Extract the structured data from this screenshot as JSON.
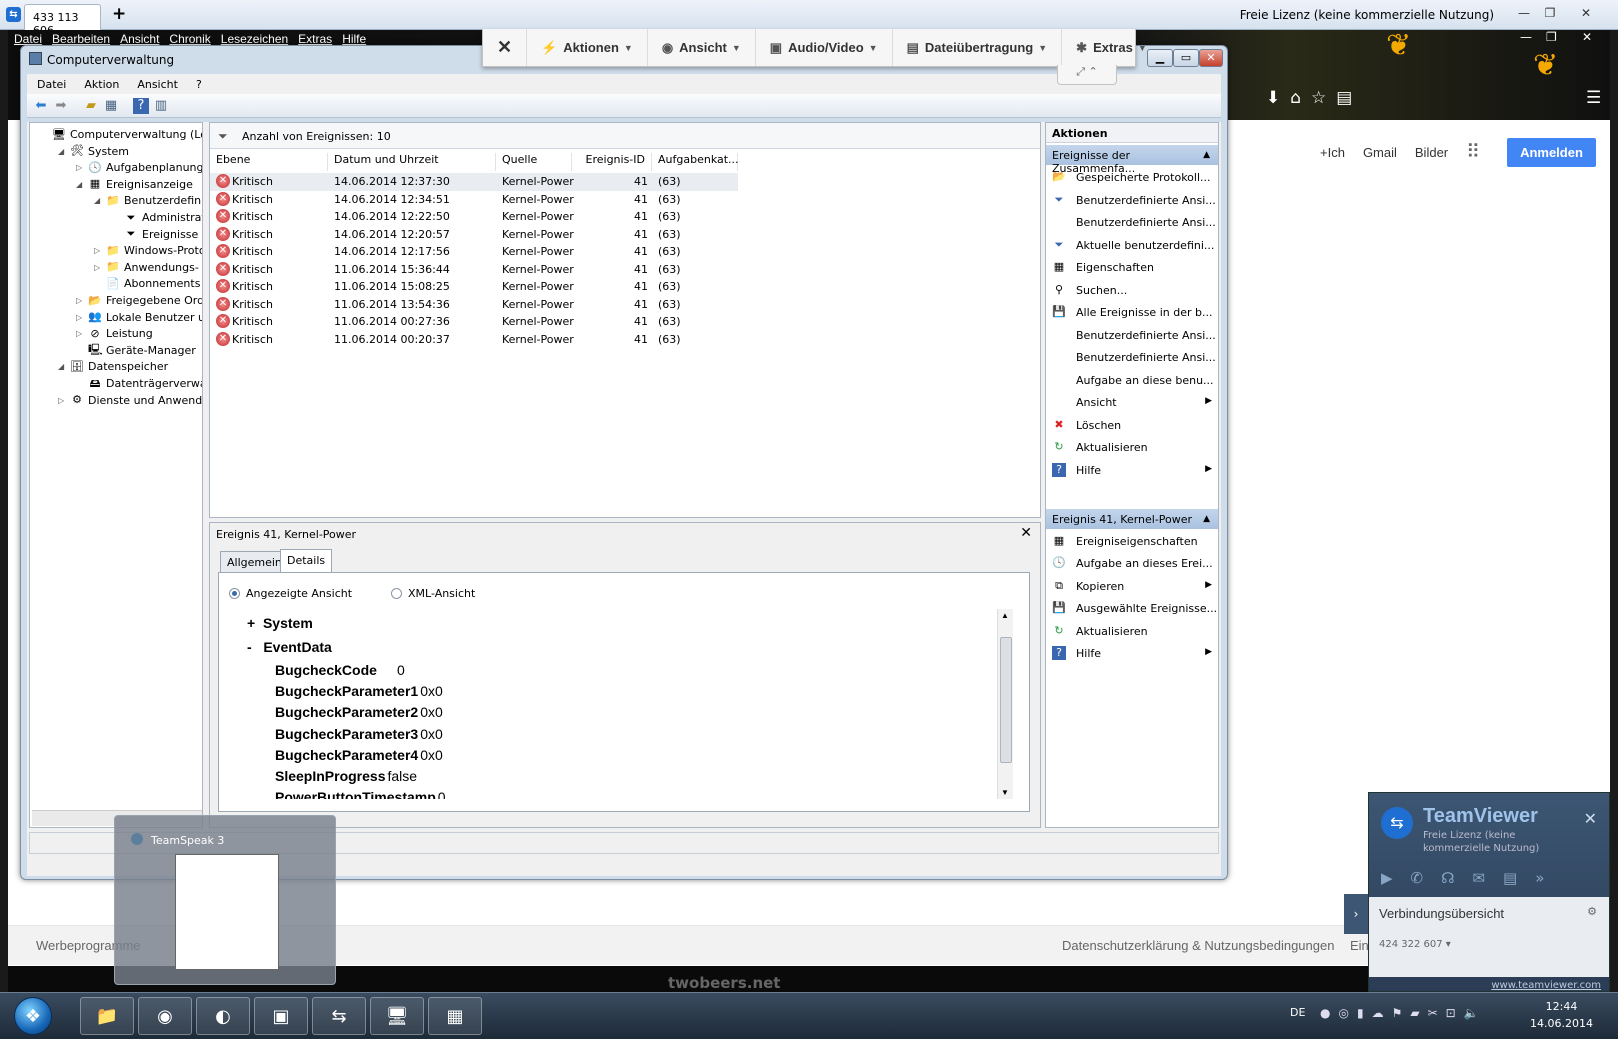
{
  "tv_window": {
    "tab_label": "433 113 606",
    "new_tab": "+",
    "license": "Freie Lizenz (keine kommerzielle Nutzung)",
    "controls": [
      "—",
      "❐",
      "✕"
    ]
  },
  "browser": {
    "menu": [
      "Datei",
      "Bearbeiten",
      "Ansicht",
      "Chronik",
      "Lesezeichen",
      "Extras",
      "Hilfe"
    ],
    "controls": [
      "—",
      "❐",
      "✕"
    ],
    "google_links": [
      "+Ich",
      "Gmail",
      "Bilder"
    ],
    "signin": "Anmelden",
    "footer_left": "Werbeprogramme",
    "footer_right": "Datenschutzerklärung & Nutzungsbedingungen",
    "footer_ein": "Ein",
    "status_brand": "twobeers.net"
  },
  "tv_toolbar": {
    "close": "✕",
    "items": [
      {
        "icon": "⚡",
        "label": "Aktionen"
      },
      {
        "icon": "◉",
        "label": "Ansicht"
      },
      {
        "icon": "▣",
        "label": "Audio/Video"
      },
      {
        "icon": "▤",
        "label": "Dateiübertragung"
      },
      {
        "icon": "✱",
        "label": "Extras"
      }
    ],
    "tab_icons": "⤢  ⌃"
  },
  "mmc": {
    "title": "Computerverwaltung",
    "menu": [
      "Datei",
      "Aktion",
      "Ansicht",
      "?"
    ],
    "tree": [
      {
        "label": "Computerverwaltung (Lokal)",
        "icon": "🖥",
        "level": 0,
        "arrow": ""
      },
      {
        "label": "System",
        "icon": "🛠",
        "level": 1,
        "arrow": "◢"
      },
      {
        "label": "Aufgabenplanung",
        "icon": "🕓",
        "level": 2,
        "arrow": "▷"
      },
      {
        "label": "Ereignisanzeige",
        "icon": "▦",
        "level": 2,
        "arrow": "◢"
      },
      {
        "label": "Benutzerdefinierte A",
        "icon": "📁",
        "level": 3,
        "arrow": "◢"
      },
      {
        "label": "Administrative E",
        "icon": "⏷",
        "level": 4,
        "arrow": ""
      },
      {
        "label": "Ereignisse der Zu",
        "icon": "⏷",
        "level": 4,
        "arrow": ""
      },
      {
        "label": "Windows-Protokolle",
        "icon": "📁",
        "level": 3,
        "arrow": "▷"
      },
      {
        "label": "Anwendungs- und D",
        "icon": "📁",
        "level": 3,
        "arrow": "▷"
      },
      {
        "label": "Abonnements",
        "icon": "📄",
        "level": 3,
        "arrow": ""
      },
      {
        "label": "Freigegebene Ordner",
        "icon": "📂",
        "level": 2,
        "arrow": "▷"
      },
      {
        "label": "Lokale Benutzer und Gr",
        "icon": "👥",
        "level": 2,
        "arrow": "▷"
      },
      {
        "label": "Leistung",
        "icon": "⊘",
        "level": 2,
        "arrow": "▷"
      },
      {
        "label": "Geräte-Manager",
        "icon": "🖳",
        "level": 2,
        "arrow": ""
      },
      {
        "label": "Datenspeicher",
        "icon": "🗄",
        "level": 1,
        "arrow": "◢"
      },
      {
        "label": "Datenträgerverwaltung",
        "icon": "🖴",
        "level": 2,
        "arrow": ""
      },
      {
        "label": "Dienste und Anwendungen",
        "icon": "⚙",
        "level": 1,
        "arrow": "▷"
      }
    ],
    "count_text": "Anzahl von Ereignissen: 10",
    "columns": [
      "Ebene",
      "Datum und Uhrzeit",
      "Quelle",
      "Ereignis-ID",
      "Aufgabenkat..."
    ],
    "events": [
      {
        "level": "Kritisch",
        "datetime": "14.06.2014 12:37:30",
        "source": "Kernel-Power",
        "id": "41",
        "cat": "(63)"
      },
      {
        "level": "Kritisch",
        "datetime": "14.06.2014 12:34:51",
        "source": "Kernel-Power",
        "id": "41",
        "cat": "(63)"
      },
      {
        "level": "Kritisch",
        "datetime": "14.06.2014 12:22:50",
        "source": "Kernel-Power",
        "id": "41",
        "cat": "(63)"
      },
      {
        "level": "Kritisch",
        "datetime": "14.06.2014 12:20:57",
        "source": "Kernel-Power",
        "id": "41",
        "cat": "(63)"
      },
      {
        "level": "Kritisch",
        "datetime": "14.06.2014 12:17:56",
        "source": "Kernel-Power",
        "id": "41",
        "cat": "(63)"
      },
      {
        "level": "Kritisch",
        "datetime": "11.06.2014 15:36:44",
        "source": "Kernel-Power",
        "id": "41",
        "cat": "(63)"
      },
      {
        "level": "Kritisch",
        "datetime": "11.06.2014 15:08:25",
        "source": "Kernel-Power",
        "id": "41",
        "cat": "(63)"
      },
      {
        "level": "Kritisch",
        "datetime": "11.06.2014 13:54:36",
        "source": "Kernel-Power",
        "id": "41",
        "cat": "(63)"
      },
      {
        "level": "Kritisch",
        "datetime": "11.06.2014 00:27:36",
        "source": "Kernel-Power",
        "id": "41",
        "cat": "(63)"
      },
      {
        "level": "Kritisch",
        "datetime": "11.06.2014 00:20:37",
        "source": "Kernel-Power",
        "id": "41",
        "cat": "(63)"
      }
    ],
    "detail": {
      "title": "Ereignis 41, Kernel-Power",
      "tabs": [
        "Allgemein",
        "Details"
      ],
      "radio_friendly": "Angezeigte Ansicht",
      "radio_xml": "XML-Ansicht",
      "system_toggle": "+",
      "system_label": "System",
      "eventdata_toggle": "-",
      "eventdata_label": "EventData",
      "fields": [
        {
          "name": "BugcheckCode",
          "value": "0"
        },
        {
          "name": "BugcheckParameter1",
          "value": "0x0"
        },
        {
          "name": "BugcheckParameter2",
          "value": "0x0"
        },
        {
          "name": "BugcheckParameter3",
          "value": "0x0"
        },
        {
          "name": "BugcheckParameter4",
          "value": "0x0"
        },
        {
          "name": "SleepInProgress",
          "value": "false"
        },
        {
          "name": "PowerButtonTimestamp",
          "value": "0"
        }
      ]
    },
    "actions": {
      "header": "Aktionen",
      "section1": "Ereignisse der Zusammenfa...",
      "items1": [
        {
          "label": "Gespeicherte Protokoll...",
          "icon": "📂",
          "arrow": ""
        },
        {
          "label": "Benutzerdefinierte Ansi...",
          "icon": "⏷",
          "arrow": ""
        },
        {
          "label": "Benutzerdefinierte Ansi...",
          "icon": "",
          "arrow": ""
        },
        {
          "label": "Aktuelle benutzerdefini...",
          "icon": "⏷",
          "arrow": ""
        },
        {
          "label": "Eigenschaften",
          "icon": "▦",
          "arrow": ""
        },
        {
          "label": "Suchen...",
          "icon": "⚲",
          "arrow": ""
        },
        {
          "label": "Alle Ereignisse in der b...",
          "icon": "💾",
          "arrow": ""
        },
        {
          "label": "Benutzerdefinierte Ansi...",
          "icon": "",
          "arrow": ""
        },
        {
          "label": "Benutzerdefinierte Ansi...",
          "icon": "",
          "arrow": ""
        },
        {
          "label": "Aufgabe an diese benu...",
          "icon": "",
          "arrow": ""
        },
        {
          "label": "Ansicht",
          "icon": "",
          "arrow": "▶"
        },
        {
          "label": "Löschen",
          "icon": "✖",
          "arrow": ""
        },
        {
          "label": "Aktualisieren",
          "icon": "↻",
          "arrow": ""
        },
        {
          "label": "Hilfe",
          "icon": "?",
          "arrow": "▶"
        }
      ],
      "section2": "Ereignis 41, Kernel-Power",
      "items2": [
        {
          "label": "Ereigniseigenschaften",
          "icon": "▦",
          "arrow": ""
        },
        {
          "label": "Aufgabe an dieses Erei...",
          "icon": "🕓",
          "arrow": ""
        },
        {
          "label": "Kopieren",
          "icon": "⧉",
          "arrow": "▶"
        },
        {
          "label": "Ausgewählte Ereignisse...",
          "icon": "💾",
          "arrow": ""
        },
        {
          "label": "Aktualisieren",
          "icon": "↻",
          "arrow": ""
        },
        {
          "label": "Hilfe",
          "icon": "?",
          "arrow": "▶"
        }
      ]
    }
  },
  "teamspeak_thumb": {
    "title": "TeamSpeak 3"
  },
  "teamviewer_panel": {
    "name": "TeamViewer",
    "license": "Freie Lizenz (keine kommerzielle Nutzung)",
    "connection_title": "Verbindungsübersicht",
    "connection_id": "424 322 607 ▾",
    "url": "www.teamviewer.com"
  },
  "taskbar": {
    "lang": "DE",
    "time": "12:44",
    "date": "14.06.2014"
  },
  "colors": {
    "accent_google": "#4285f4",
    "critical": "#c0282a",
    "action_section": "#a9c1e0"
  }
}
